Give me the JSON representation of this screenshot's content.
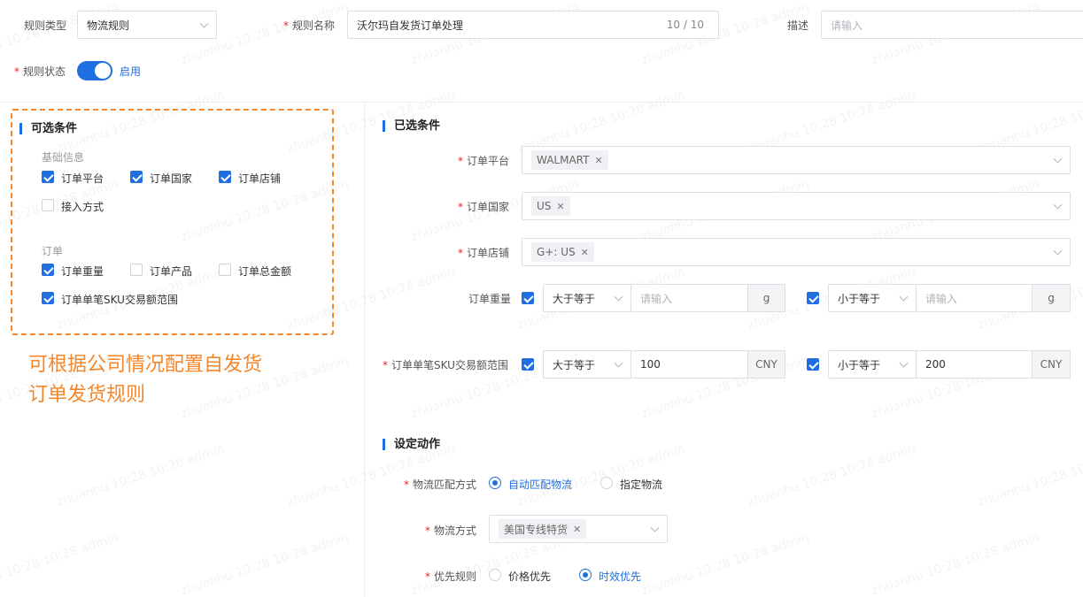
{
  "header": {
    "rule_type_label": "规则类型",
    "rule_type_value": "物流规则",
    "rule_name_label": "规则名称",
    "rule_name_value": "沃尔玛自发货订单处理",
    "rule_name_count": "10 / 10",
    "desc_label": "描述",
    "desc_placeholder": "请输入",
    "status_label": "规则状态",
    "status_value": "启用"
  },
  "left": {
    "title": "可选条件",
    "groups": [
      {
        "title": "基础信息",
        "items": [
          {
            "label": "订单平台",
            "checked": true
          },
          {
            "label": "订单国家",
            "checked": true
          },
          {
            "label": "订单店铺",
            "checked": true
          },
          {
            "label": "接入方式",
            "checked": false
          }
        ]
      },
      {
        "title": "订单",
        "items": [
          {
            "label": "订单重量",
            "checked": true
          },
          {
            "label": "订单产品",
            "checked": false
          },
          {
            "label": "订单总金额",
            "checked": false
          },
          {
            "label": "订单单笔SKU交易额范围",
            "checked": true
          }
        ]
      }
    ],
    "annotation_line1": "可根据公司情况配置自发货",
    "annotation_line2": "订单发货规则"
  },
  "selected": {
    "title": "已选条件",
    "platform_label": "订单平台",
    "platform_tag": "WALMART",
    "country_label": "订单国家",
    "country_tag": "US",
    "store_label": "订单店铺",
    "store_tag": "G+: US",
    "weight_label": "订单重量",
    "weight_op1": "大于等于",
    "weight_val1_placeholder": "请输入",
    "weight_unit": "g",
    "weight_op2": "小于等于",
    "weight_val2_placeholder": "请输入",
    "sku_label": "订单单笔SKU交易额范围",
    "sku_op1": "大于等于",
    "sku_val1": "100",
    "sku_unit": "CNY",
    "sku_op2": "小于等于",
    "sku_val2": "200"
  },
  "actions": {
    "title": "设定动作",
    "match_label": "物流匹配方式",
    "match_opt1": "自动匹配物流",
    "match_opt2": "指定物流",
    "method_label": "物流方式",
    "method_tag": "美国专线特货",
    "priority_label": "优先规则",
    "priority_opt1": "价格优先",
    "priority_opt2": "时效优先"
  },
  "watermark": "zhuanhu 10:28 10:28 admin",
  "colors": {
    "accent": "#1f6fe0",
    "annotation": "#f5862a",
    "required": "#f5222d"
  }
}
